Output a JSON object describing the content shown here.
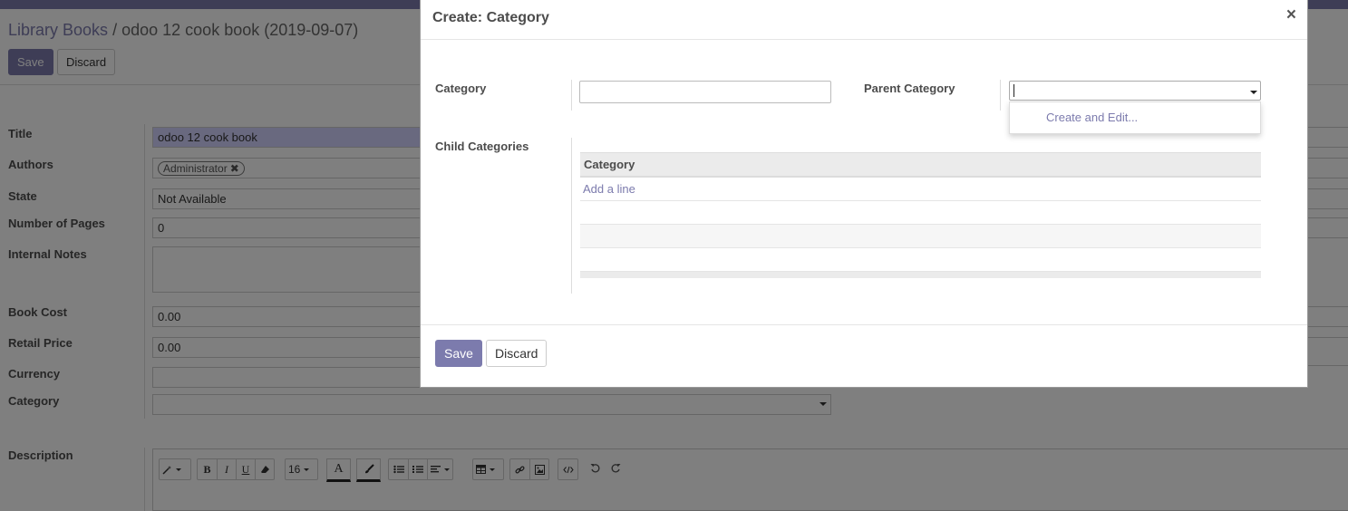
{
  "breadcrumb": {
    "parent": "Library Books",
    "separator": "/",
    "current": "odoo 12 cook book (2019-09-07)"
  },
  "form_buttons": {
    "save": "Save",
    "discard": "Discard"
  },
  "fields": {
    "title": {
      "label": "Title",
      "value": "odoo 12 cook book"
    },
    "authors": {
      "label": "Authors",
      "tag": "Administrator",
      "remove": "✖"
    },
    "state": {
      "label": "State",
      "value": "Not Available"
    },
    "pages": {
      "label": "Number of Pages",
      "value": "0"
    },
    "notes": {
      "label": "Internal Notes",
      "value": ""
    },
    "cost": {
      "label": "Book Cost",
      "value": "0.00"
    },
    "retail": {
      "label": "Retail Price",
      "value": "0.00"
    },
    "currency": {
      "label": "Currency",
      "value": ""
    },
    "category": {
      "label": "Category",
      "value": ""
    },
    "description": {
      "label": "Description"
    }
  },
  "editor_toolbar": {
    "font_size": "16",
    "icons": [
      "magic-wand-icon",
      "bold-icon",
      "italic-icon",
      "underline-icon",
      "eraser-icon",
      "font-color-icon",
      "background-color-icon",
      "unordered-list-icon",
      "ordered-list-icon",
      "align-icon",
      "table-icon",
      "link-icon",
      "image-icon",
      "code-view-icon",
      "undo-icon",
      "redo-icon"
    ],
    "bold": "B",
    "italic": "I",
    "underline": "U",
    "font_color": "A"
  },
  "modal": {
    "title": "Create: Category",
    "close": "×",
    "category_label": "Category",
    "category_value": "",
    "parent_label": "Parent Category",
    "parent_value": "",
    "dropdown_option": "Create and Edit...",
    "child_label": "Child Categories",
    "child_table": {
      "column": "Category",
      "add_line": "Add a line"
    },
    "save": "Save",
    "discard": "Discard"
  },
  "colors": {
    "primary": "#7c7bad",
    "required_bg": "#d2d2ff",
    "label": "#4c4c4c"
  }
}
